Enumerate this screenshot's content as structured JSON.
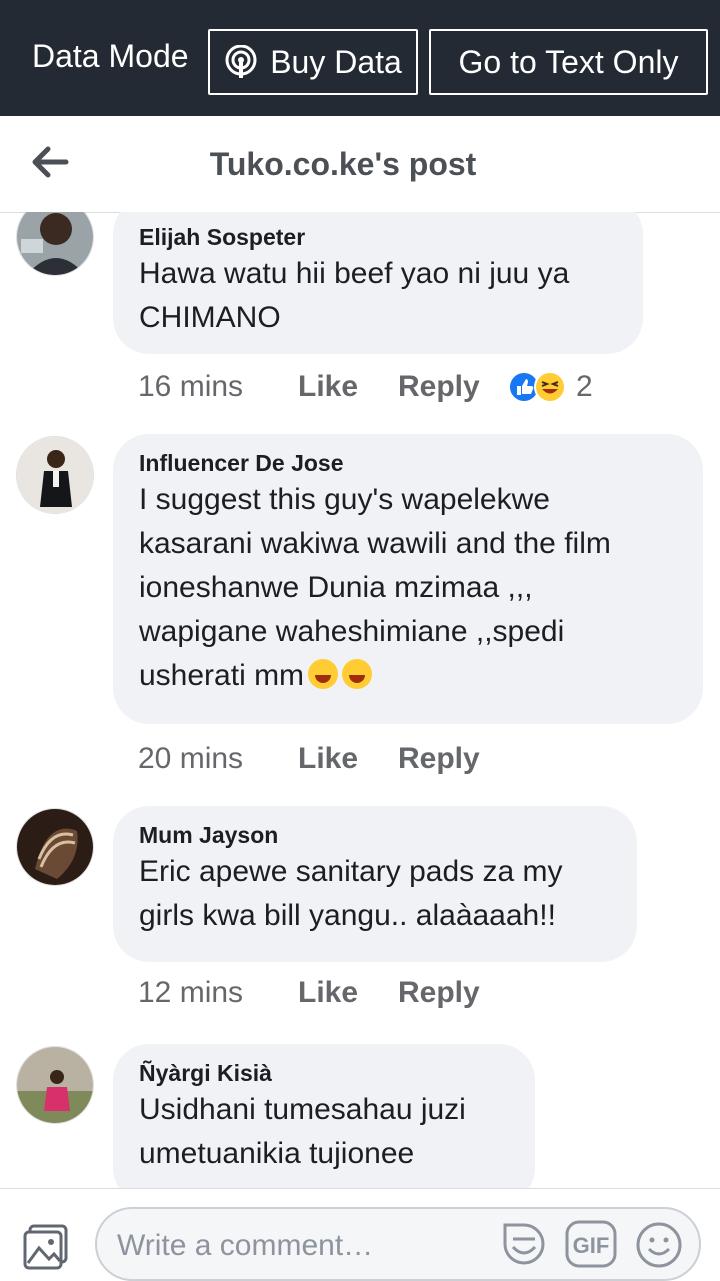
{
  "topbar": {
    "data_mode_label": "Data Mode",
    "buy_data_label": "Buy Data",
    "text_only_label": "Go to Text Only"
  },
  "header": {
    "title": "Tuko.co.ke's post"
  },
  "comments": [
    {
      "author": "Elijah Sospeter",
      "lines": [
        "Hawa watu hii beef yao ni juu ya",
        "CHIMANO"
      ],
      "time": "16 mins",
      "like": "Like",
      "reply": "Reply",
      "reaction_count": "2"
    },
    {
      "author": "Influencer De Jose",
      "lines": [
        "I suggest this guy's wapelekwe",
        "kasarani wakiwa wawili and the film",
        "ioneshanwe Dunia mzimaa ,,,",
        "wapigane waheshimiane ,,spedi",
        "usherati mm"
      ],
      "time": "20 mins",
      "like": "Like",
      "reply": "Reply"
    },
    {
      "author": "Mum Jayson",
      "lines": [
        "Eric apewe sanitary pads za my",
        "girls kwa bill yangu.. alaàaaah!!"
      ],
      "time": "12 mins",
      "like": "Like",
      "reply": "Reply"
    },
    {
      "author": "Ñyàrgi Kisià",
      "lines": [
        "Usidhani tumesahau juzi",
        "umetuanikia tujionee"
      ]
    }
  ],
  "composer": {
    "placeholder": "Write a comment…",
    "gif_label": "GIF"
  },
  "colors": {
    "topbar_bg": "#242a33",
    "bubble_bg": "#f0f2f5",
    "meta_text": "#65676b",
    "like_reaction": "#1877f2",
    "haha_reaction": "#ffcc33"
  }
}
